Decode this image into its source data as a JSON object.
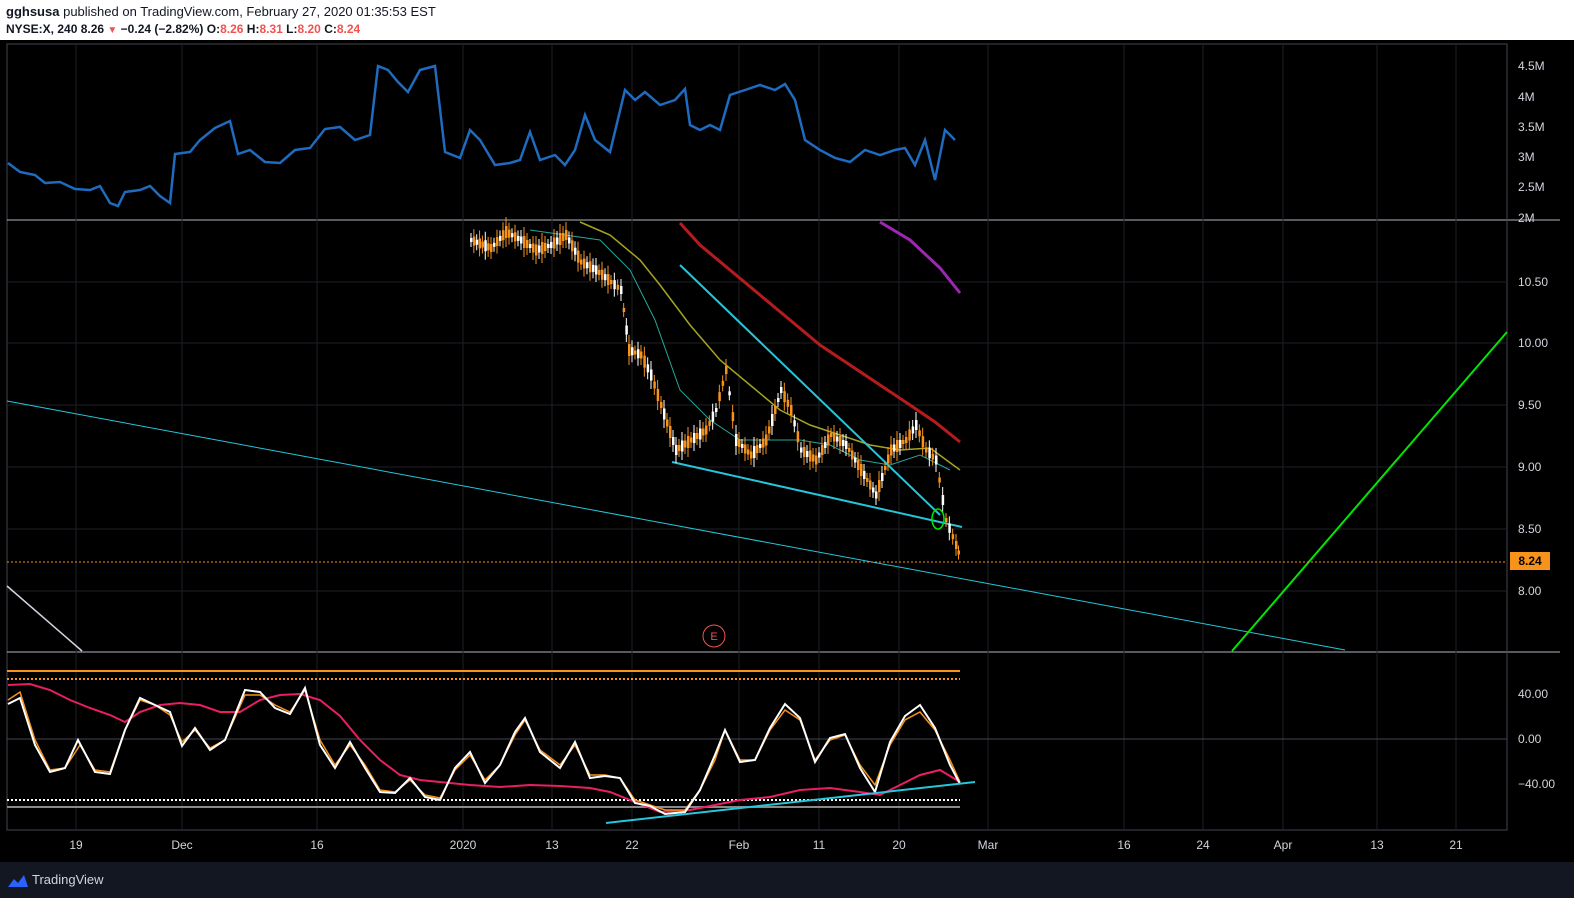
{
  "header": {
    "publisher": "gghsusa",
    "published_text": "published on TradingView.com, February 27, 2020 01:35:53 EST",
    "symbol": "NYSE:X, 240",
    "last": "8.26",
    "change": "−0.24 (−2.82%)",
    "o_label": "O:",
    "o_value": "8.26",
    "h_label": "H:",
    "h_value": "8.31",
    "l_label": "L:",
    "l_value": "8.20",
    "c_label": "C:",
    "c_value": "8.24"
  },
  "volume_axis": [
    "4.5M",
    "4M",
    "3.5M",
    "3M",
    "2.5M",
    "2M"
  ],
  "price_axis": [
    "10.50",
    "10.00",
    "9.50",
    "9.00",
    "8.50",
    "8.00"
  ],
  "last_price_tag": "8.24",
  "osc_axis": [
    "40.00",
    "0.00",
    "−40.00"
  ],
  "time_axis": [
    "19",
    "Dec",
    "16",
    "2020",
    "13",
    "22",
    "Feb",
    "11",
    "20",
    "Mar",
    "16",
    "24",
    "Apr",
    "13",
    "21"
  ],
  "earnings_marker": "E",
  "footer_logo": "TradingView",
  "colors": {
    "volume_line": "#1e6bbf",
    "candle_up": "#ffffff",
    "candle_down": "#f7931a",
    "ma_red": "#b71c1c",
    "ma_purple": "#9c27b0",
    "ma_olive": "#a4a424",
    "ma_teal": "#26a69a",
    "trend_cyan": "#26c6da",
    "trend_green": "#00e600",
    "osc_white": "#ffffff",
    "osc_orange": "#f7931a",
    "osc_pink": "#e91e63"
  }
}
